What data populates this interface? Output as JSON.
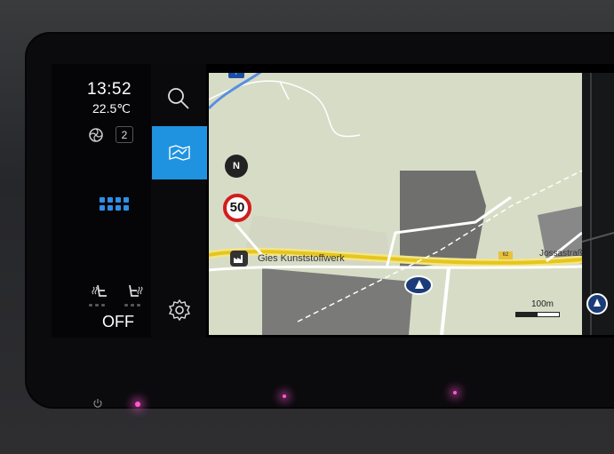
{
  "status": {
    "time": "13:52",
    "temperature": "22.5℃",
    "fan_level": "2",
    "seat_heating_status": "OFF"
  },
  "rail": {
    "search_icon": "search-icon",
    "navigation_icon": "map-icon",
    "settings_icon": "gear-icon",
    "active_color": "#1f93e0"
  },
  "map": {
    "compass": "N",
    "speed_limit": "50",
    "poi_label": "Gies Kunststoffwerk",
    "street_label": "Jossastraße",
    "route_number": "62",
    "route_number_top": "7",
    "scale_label": "100m"
  },
  "icons": {
    "fan": "fan-icon",
    "apps": "apps-grid-icon",
    "seat_left": "seat-heat-left-icon",
    "seat_right": "seat-heat-right-icon",
    "power": "power-icon",
    "factory": "factory-icon",
    "vehicle": "vehicle-position-icon"
  }
}
